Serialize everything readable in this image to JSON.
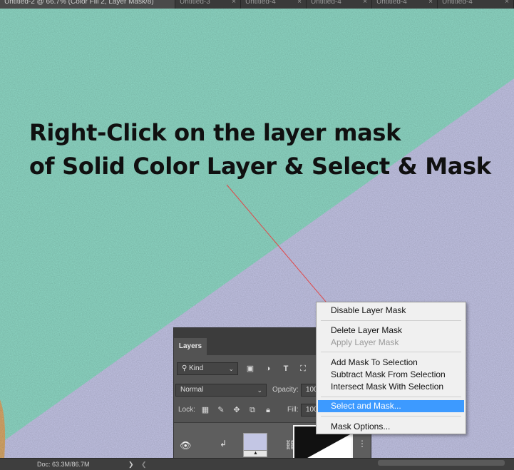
{
  "tabs": [
    {
      "label": "Untitled-2 @ 66.7% (Color Fill 2, Layer Mask/8)",
      "active": true
    },
    {
      "label": "Untitled-3",
      "active": false
    },
    {
      "label": "Untitled-4",
      "active": false
    },
    {
      "label": "Untitled-4",
      "active": false
    },
    {
      "label": "Untitled-4",
      "active": false
    },
    {
      "label": "Untitled-4",
      "active": false
    }
  ],
  "tab_close": "×",
  "annotation": {
    "line1": "Right-Click on the layer mask",
    "line2": "of Solid Color Layer & Select & Mask"
  },
  "colors": {
    "teal": "#8fd9c6",
    "lavender": "#c4c5e6",
    "arrow": "#e04848",
    "menu_highlight": "#3d9aff"
  },
  "layers_panel": {
    "tab_label": "Layers",
    "filter_kind": "Kind",
    "blend_mode": "Normal",
    "opacity_label": "Opacity:",
    "opacity_value": "100",
    "lock_label": "Lock:",
    "fill_label": "Fill:",
    "fill_value": "100",
    "filter_icons": [
      "image-icon",
      "adjustment-icon",
      "type-icon",
      "shape-icon"
    ],
    "lock_icons": [
      "lock-pixels-icon",
      "lock-paint-icon",
      "lock-move-icon",
      "lock-artboard-icon",
      "lock-all-icon"
    ]
  },
  "status_bar": {
    "doc": "Doc: 63.3M/86.7M",
    "arrow": "❯",
    "scroll_left": "❮"
  },
  "context_menu": {
    "items": [
      {
        "label": "Disable Layer Mask",
        "disabled": false
      },
      {
        "label": "Delete Layer Mask",
        "disabled": false
      },
      {
        "label": "Apply Layer Mask",
        "disabled": true
      },
      {
        "label": "Add Mask To Selection",
        "disabled": false
      },
      {
        "label": "Subtract Mask From Selection",
        "disabled": false
      },
      {
        "label": "Intersect Mask With Selection",
        "disabled": false
      },
      {
        "label": "Select and Mask...",
        "disabled": false,
        "highlighted": true
      },
      {
        "label": "Mask Options...",
        "disabled": false
      }
    ]
  }
}
